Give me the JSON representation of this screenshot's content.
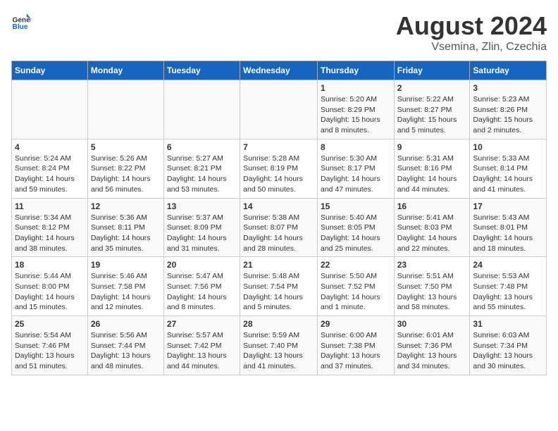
{
  "header": {
    "logo": {
      "general": "General",
      "blue": "Blue"
    },
    "title": "August 2024",
    "subtitle": "Vsemina, Zlin, Czechia"
  },
  "days_of_week": [
    "Sunday",
    "Monday",
    "Tuesday",
    "Wednesday",
    "Thursday",
    "Friday",
    "Saturday"
  ],
  "weeks": [
    [
      {
        "day": "",
        "info": ""
      },
      {
        "day": "",
        "info": ""
      },
      {
        "day": "",
        "info": ""
      },
      {
        "day": "",
        "info": ""
      },
      {
        "day": "1",
        "info": "Sunrise: 5:20 AM\nSunset: 8:29 PM\nDaylight: 15 hours\nand 8 minutes."
      },
      {
        "day": "2",
        "info": "Sunrise: 5:22 AM\nSunset: 8:27 PM\nDaylight: 15 hours\nand 5 minutes."
      },
      {
        "day": "3",
        "info": "Sunrise: 5:23 AM\nSunset: 8:26 PM\nDaylight: 15 hours\nand 2 minutes."
      }
    ],
    [
      {
        "day": "4",
        "info": "Sunrise: 5:24 AM\nSunset: 8:24 PM\nDaylight: 14 hours\nand 59 minutes."
      },
      {
        "day": "5",
        "info": "Sunrise: 5:26 AM\nSunset: 8:22 PM\nDaylight: 14 hours\nand 56 minutes."
      },
      {
        "day": "6",
        "info": "Sunrise: 5:27 AM\nSunset: 8:21 PM\nDaylight: 14 hours\nand 53 minutes."
      },
      {
        "day": "7",
        "info": "Sunrise: 5:28 AM\nSunset: 8:19 PM\nDaylight: 14 hours\nand 50 minutes."
      },
      {
        "day": "8",
        "info": "Sunrise: 5:30 AM\nSunset: 8:17 PM\nDaylight: 14 hours\nand 47 minutes."
      },
      {
        "day": "9",
        "info": "Sunrise: 5:31 AM\nSunset: 8:16 PM\nDaylight: 14 hours\nand 44 minutes."
      },
      {
        "day": "10",
        "info": "Sunrise: 5:33 AM\nSunset: 8:14 PM\nDaylight: 14 hours\nand 41 minutes."
      }
    ],
    [
      {
        "day": "11",
        "info": "Sunrise: 5:34 AM\nSunset: 8:12 PM\nDaylight: 14 hours\nand 38 minutes."
      },
      {
        "day": "12",
        "info": "Sunrise: 5:36 AM\nSunset: 8:11 PM\nDaylight: 14 hours\nand 35 minutes."
      },
      {
        "day": "13",
        "info": "Sunrise: 5:37 AM\nSunset: 8:09 PM\nDaylight: 14 hours\nand 31 minutes."
      },
      {
        "day": "14",
        "info": "Sunrise: 5:38 AM\nSunset: 8:07 PM\nDaylight: 14 hours\nand 28 minutes."
      },
      {
        "day": "15",
        "info": "Sunrise: 5:40 AM\nSunset: 8:05 PM\nDaylight: 14 hours\nand 25 minutes."
      },
      {
        "day": "16",
        "info": "Sunrise: 5:41 AM\nSunset: 8:03 PM\nDaylight: 14 hours\nand 22 minutes."
      },
      {
        "day": "17",
        "info": "Sunrise: 5:43 AM\nSunset: 8:01 PM\nDaylight: 14 hours\nand 18 minutes."
      }
    ],
    [
      {
        "day": "18",
        "info": "Sunrise: 5:44 AM\nSunset: 8:00 PM\nDaylight: 14 hours\nand 15 minutes."
      },
      {
        "day": "19",
        "info": "Sunrise: 5:46 AM\nSunset: 7:58 PM\nDaylight: 14 hours\nand 12 minutes."
      },
      {
        "day": "20",
        "info": "Sunrise: 5:47 AM\nSunset: 7:56 PM\nDaylight: 14 hours\nand 8 minutes."
      },
      {
        "day": "21",
        "info": "Sunrise: 5:48 AM\nSunset: 7:54 PM\nDaylight: 14 hours\nand 5 minutes."
      },
      {
        "day": "22",
        "info": "Sunrise: 5:50 AM\nSunset: 7:52 PM\nDaylight: 14 hours\nand 1 minute."
      },
      {
        "day": "23",
        "info": "Sunrise: 5:51 AM\nSunset: 7:50 PM\nDaylight: 13 hours\nand 58 minutes."
      },
      {
        "day": "24",
        "info": "Sunrise: 5:53 AM\nSunset: 7:48 PM\nDaylight: 13 hours\nand 55 minutes."
      }
    ],
    [
      {
        "day": "25",
        "info": "Sunrise: 5:54 AM\nSunset: 7:46 PM\nDaylight: 13 hours\nand 51 minutes."
      },
      {
        "day": "26",
        "info": "Sunrise: 5:56 AM\nSunset: 7:44 PM\nDaylight: 13 hours\nand 48 minutes."
      },
      {
        "day": "27",
        "info": "Sunrise: 5:57 AM\nSunset: 7:42 PM\nDaylight: 13 hours\nand 44 minutes."
      },
      {
        "day": "28",
        "info": "Sunrise: 5:59 AM\nSunset: 7:40 PM\nDaylight: 13 hours\nand 41 minutes."
      },
      {
        "day": "29",
        "info": "Sunrise: 6:00 AM\nSunset: 7:38 PM\nDaylight: 13 hours\nand 37 minutes."
      },
      {
        "day": "30",
        "info": "Sunrise: 6:01 AM\nSunset: 7:36 PM\nDaylight: 13 hours\nand 34 minutes."
      },
      {
        "day": "31",
        "info": "Sunrise: 6:03 AM\nSunset: 7:34 PM\nDaylight: 13 hours\nand 30 minutes."
      }
    ]
  ]
}
